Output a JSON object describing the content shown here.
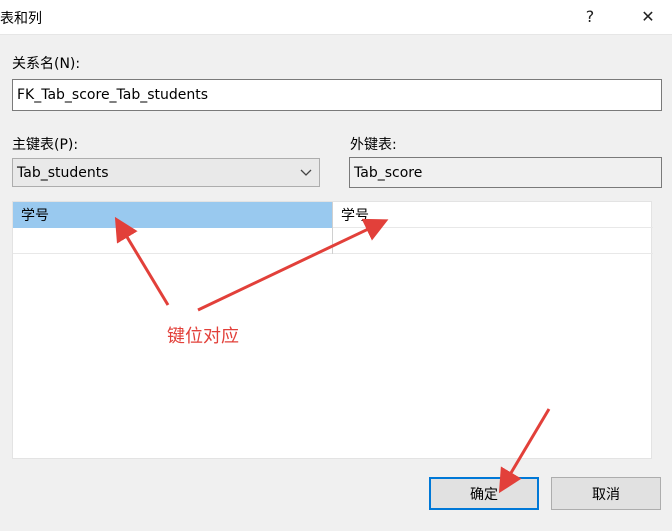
{
  "window": {
    "title": "表和列",
    "help_glyph": "?",
    "close_glyph": "✕"
  },
  "relationship": {
    "name_label": "关系名(N):",
    "name_value": "FK_Tab_score_Tab_students"
  },
  "primary_table": {
    "label": "主键表(P):",
    "selected": "Tab_students"
  },
  "foreign_table": {
    "label": "外键表:",
    "value": "Tab_score"
  },
  "columns": {
    "rows": [
      {
        "primary": "学号",
        "foreign": "学号"
      },
      {
        "primary": "",
        "foreign": ""
      }
    ]
  },
  "annotation": {
    "text": "键位对应",
    "color": "#e2403a"
  },
  "buttons": {
    "ok_label": "确定",
    "cancel_label": "取消"
  },
  "colors": {
    "selection": "#99c9ef",
    "default_button_border": "#0078d7",
    "dialog_background": "#f0f0f0"
  }
}
